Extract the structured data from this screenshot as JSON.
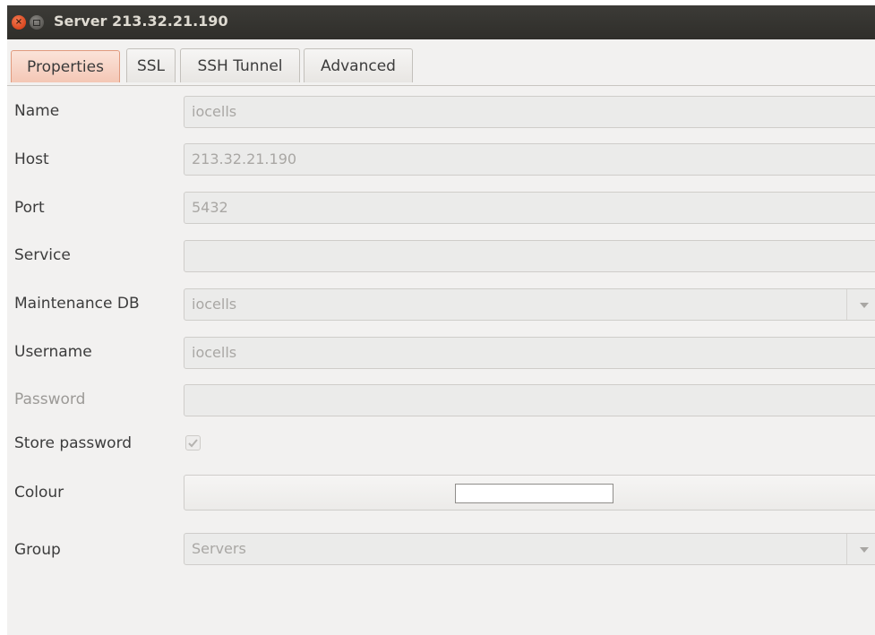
{
  "window": {
    "title": "Server 213.32.21.190",
    "close_glyph": "×"
  },
  "tabs": [
    {
      "label": "Properties",
      "active": true
    },
    {
      "label": "SSL",
      "active": false
    },
    {
      "label": "SSH Tunnel",
      "active": false
    },
    {
      "label": "Advanced",
      "active": false
    }
  ],
  "form": {
    "name": {
      "label": "Name",
      "value": "iocells"
    },
    "host": {
      "label": "Host",
      "value": "213.32.21.190"
    },
    "port": {
      "label": "Port",
      "value": "5432"
    },
    "service": {
      "label": "Service",
      "value": ""
    },
    "maintenance_db": {
      "label": "Maintenance DB",
      "value": "iocells"
    },
    "username": {
      "label": "Username",
      "value": "iocells"
    },
    "password": {
      "label": "Password",
      "value": ""
    },
    "store_password": {
      "label": "Store password",
      "checked": true
    },
    "colour": {
      "label": "Colour",
      "value": "#ffffff"
    },
    "group": {
      "label": "Group",
      "value": "Servers"
    }
  },
  "colors": {
    "accent_tab": "#f4c7b5",
    "titlebar": "#3c3b37",
    "close_button": "#e05a2f"
  }
}
